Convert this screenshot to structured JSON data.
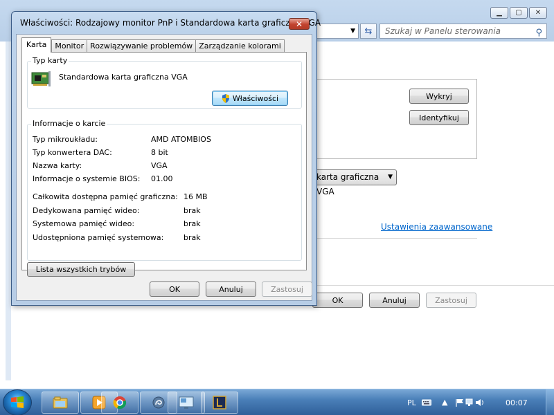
{
  "background_window": {
    "search_placeholder": "Szukaj w Panelu sterowania",
    "detect_label": "Wykryj",
    "identify_label": "Identyfikuj",
    "display_combo_value": "karta graficzna VGA",
    "advanced_link": "Ustawienia zaawansowane",
    "ok_label": "OK",
    "cancel_label": "Anuluj",
    "apply_label": "Zastosuj"
  },
  "dialog": {
    "title": "Właściwości: Rodzajowy monitor PnP i Standardowa karta graficzna VGA",
    "close_symbol": "✕",
    "tabs": [
      {
        "label": "Karta",
        "active": true
      },
      {
        "label": "Monitor",
        "active": false
      },
      {
        "label": "Rozwiązywanie problemów",
        "active": false
      },
      {
        "label": "Zarządzanie kolorami",
        "active": false
      }
    ],
    "adapter_type": {
      "group_label": "Typ karty",
      "name": "Standardowa karta graficzna VGA",
      "properties_label": "Właściwości"
    },
    "adapter_info": {
      "group_label": "Informacje o karcie",
      "rows": [
        {
          "label": "Typ mikroukładu:",
          "value": "AMD ATOMBIOS"
        },
        {
          "label": "Typ konwertera DAC:",
          "value": "8 bit"
        },
        {
          "label": "Nazwa karty:",
          "value": "VGA"
        },
        {
          "label": "Informacje o systemie BIOS:",
          "value": "01.00"
        }
      ],
      "memory_rows": [
        {
          "label": "Całkowita dostępna pamięć graficzna:",
          "value": "16 MB"
        },
        {
          "label": "Dedykowana pamięć wideo:",
          "value": "brak"
        },
        {
          "label": "Systemowa pamięć wideo:",
          "value": "brak"
        },
        {
          "label": "Udostępniona pamięć systemowa:",
          "value": "brak"
        }
      ]
    },
    "list_modes_label": "Lista wszystkich trybów",
    "ok_label": "OK",
    "cancel_label": "Anuluj",
    "apply_label": "Zastosuj"
  },
  "taskbar": {
    "language": "PL",
    "clock": "00:07",
    "pinned": [
      "explorer-icon",
      "media-player-icon",
      "chrome-icon",
      "cortana-like-icon",
      "control-panel-icon",
      "app-l-icon"
    ]
  },
  "colors": {
    "link": "#0066cc",
    "taskbar": "#2f5f99",
    "dialog_frame": "#b7cde6"
  }
}
